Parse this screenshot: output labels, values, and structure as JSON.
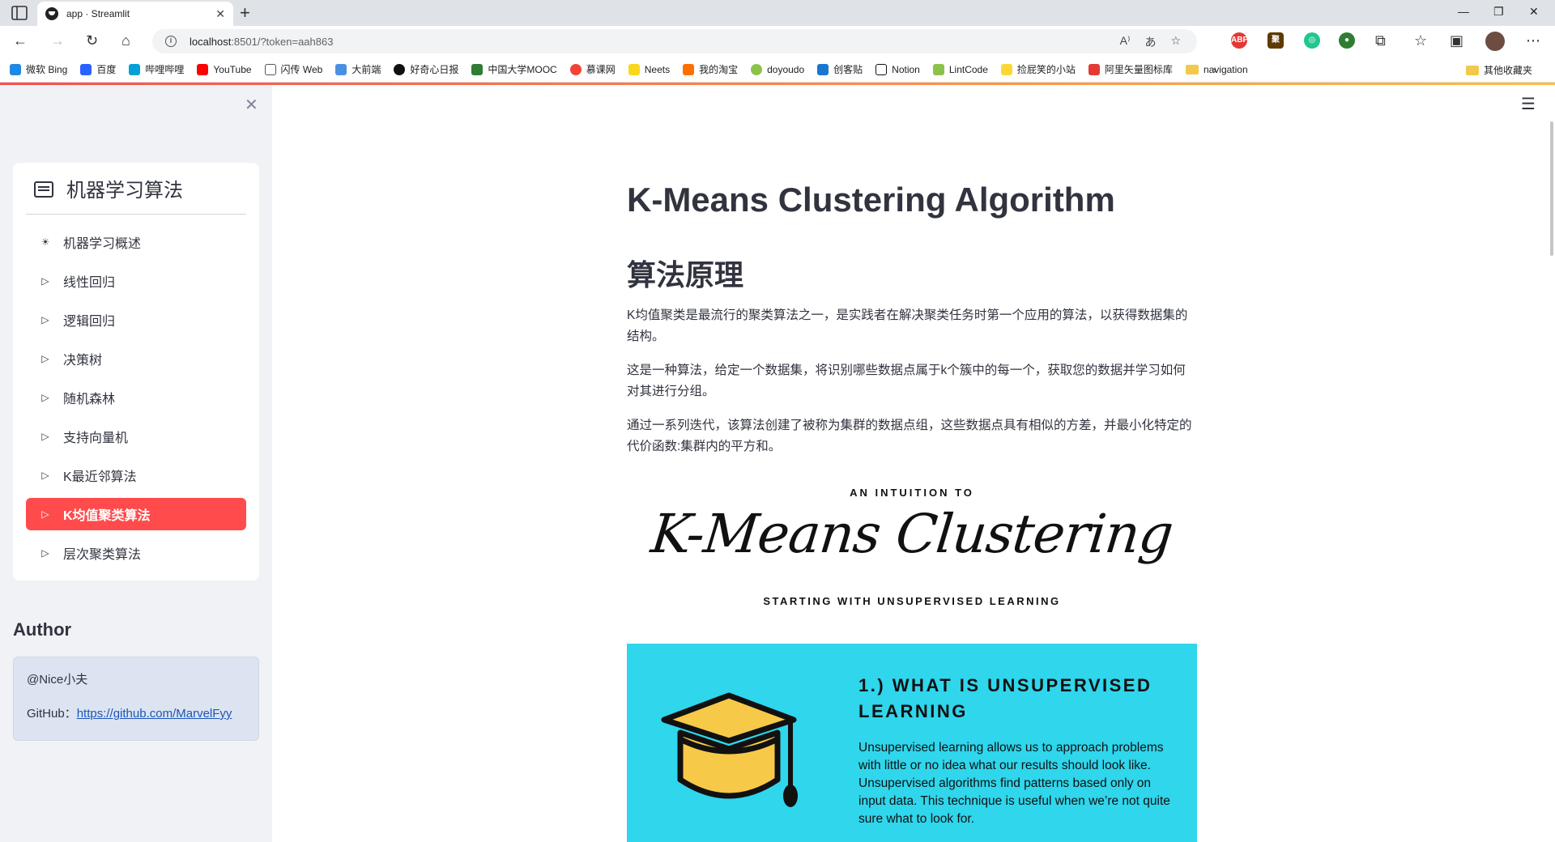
{
  "browser": {
    "tab_title": "app · Streamlit",
    "url_host": "localhost",
    "url_rest": ":8501/?token=aah863",
    "bookmarks": [
      "微软 Bing",
      "百度",
      "哔哩哔哩",
      "YouTube",
      "闪传 Web",
      "大前端",
      "好奇心日报",
      "中国大学MOOC",
      "慕课网",
      "Neets",
      "我的淘宝",
      "doyoudo",
      "创客贴",
      "Notion",
      "LintCode",
      "捡屁笑的小站",
      "阿里矢量图标库",
      "navigation"
    ],
    "other_bookmarks": "其他收藏夹",
    "colors": {
      "accent": "#ff4b4b",
      "accent2": "#ffbd45"
    }
  },
  "sidebar": {
    "menu_title": "机器学习算法",
    "items": [
      {
        "label": "机器学习概述",
        "icon": "sun-icon"
      },
      {
        "label": "线性回归",
        "icon": "play-outline-icon"
      },
      {
        "label": "逻辑回归",
        "icon": "play-outline-icon"
      },
      {
        "label": "决策树",
        "icon": "play-outline-icon"
      },
      {
        "label": "随机森林",
        "icon": "play-outline-icon"
      },
      {
        "label": "支持向量机",
        "icon": "play-outline-icon"
      },
      {
        "label": "K最近邻算法",
        "icon": "play-outline-icon"
      },
      {
        "label": "K均值聚类算法",
        "icon": "play-outline-icon",
        "active": true
      },
      {
        "label": "层次聚类算法",
        "icon": "play-outline-icon"
      }
    ],
    "author_heading": "Author",
    "author_name": "@Nice小夫",
    "github_label": "GitHub：",
    "github_link": "https://github.com/MarvelFyy"
  },
  "main": {
    "title": "K-Means Clustering Algorithm",
    "section_heading": "算法原理",
    "paragraphs": [
      "K均值聚类是最流行的聚类算法之一，是实践者在解决聚类任务时第一个应用的算法，以获得数据集的结构。",
      "这是一种算法，给定一个数据集，将识别哪些数据点属于k个簇中的每一个，获取您的数据并学习如何对其进行分组。",
      "通过一系列迭代，该算法创建了被称为集群的数据点组，这些数据点具有相似的方差，并最小化特定的代价函数:集群内的平方和。"
    ],
    "figure": {
      "kicker": "AN INTUITION TO",
      "script_title": "K-Means Clustering",
      "subtitle": "STARTING WITH UNSUPERVISED LEARNING",
      "section_title": "1.) WHAT IS UNSUPERVISED LEARNING",
      "section_body": "Unsupervised learning allows us to approach problems with little or no idea what our results should look like. Unsupervised algorithms find patterns based only on input data. This technique is useful when we’re not quite sure what to look for.",
      "colors": {
        "panel": "#2fd6ec",
        "cap": "#f7c948"
      }
    }
  }
}
